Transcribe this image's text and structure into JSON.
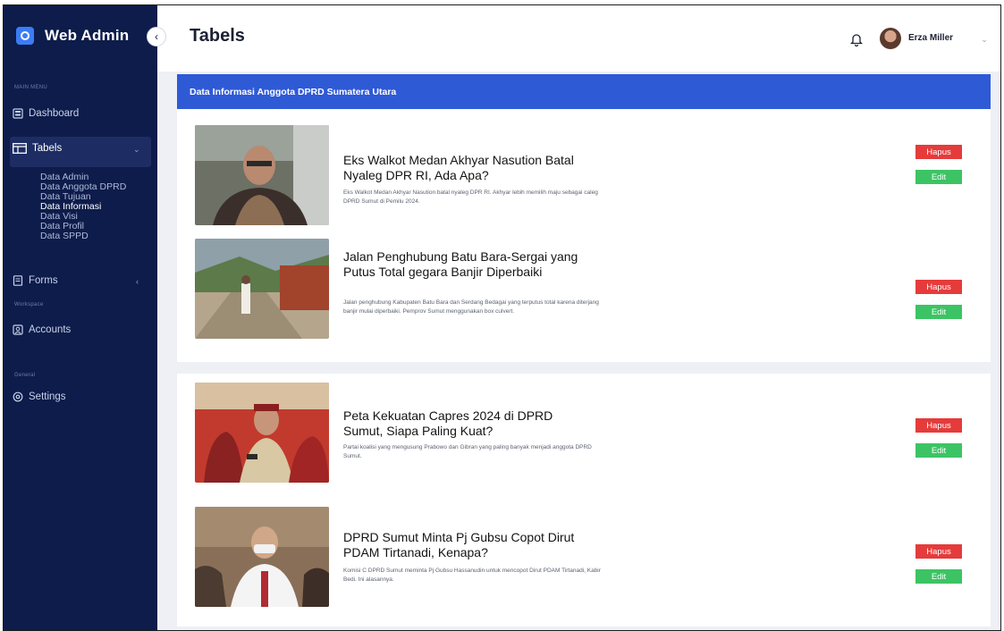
{
  "app": {
    "name": "Web Admin"
  },
  "sidebar": {
    "main_menu_label": "MAIN MENU",
    "workspace_label": "Workspace",
    "general_label": "General",
    "dashboard": "Dashboard",
    "tabels": "Tabels",
    "tabels_sub": [
      "Data Admin",
      "Data Anggota DPRD",
      "Data Tujuan",
      "Data Informasi",
      "Data Visi",
      "Data Profil",
      "Data SPPD"
    ],
    "active_sub": "Data Informasi",
    "forms": "Forms",
    "accounts": "Accounts",
    "settings": "Settings"
  },
  "topbar": {
    "title": "Tabels",
    "user_name": "Erza Miller"
  },
  "panel": {
    "title": "Data Informasi Anggota DPRD Sumatera Utara"
  },
  "articles": [
    {
      "title": "Eks Walkot Medan Akhyar Nasution Batal Nyaleg DPR RI, Ada Apa?",
      "desc": "Eks Walkot Medan Akhyar Nasution batal nyaleg DPR RI. Akhyar lebih memilih maju sebagai caleg DPRD Sumut di Pemilu 2024.",
      "hapus": "Hapus",
      "edit": "Edit"
    },
    {
      "title": "Jalan Penghubung Batu Bara-Sergai yang Putus Total gegara Banjir Diperbaiki",
      "desc": "Jalan penghubung Kabupaten Batu Bara dan Serdang Bedagai yang terputus total karena diterjang banjir mulai diperbaiki. Pemprov Sumut menggunakan box culvert.",
      "hapus": "Hapus",
      "edit": "Edit"
    },
    {
      "title": "Peta Kekuatan Capres 2024 di DPRD Sumut, Siapa Paling Kuat?",
      "desc": "Partai koalisi yang mengusung Prabowo dan Gibran yang paling banyak menjadi anggota DPRD Sumut.",
      "hapus": "Hapus",
      "edit": "Edit"
    },
    {
      "title": "DPRD Sumut Minta Pj Gubsu Copot Dirut PDAM Tirtanadi, Kenapa?",
      "desc": "Komisi C DPRD Sumut meminta Pj Gubsu Hassanudin untuk mencopot Dirut PDAM Tirtanadi, Kabir Bedi. Ini alasannya.",
      "hapus": "Hapus",
      "edit": "Edit"
    }
  ],
  "colors": {
    "sidebar": "#0d1c4a",
    "accent": "#2f5ad6",
    "delete": "#e53b3b",
    "edit": "#3cc464"
  }
}
